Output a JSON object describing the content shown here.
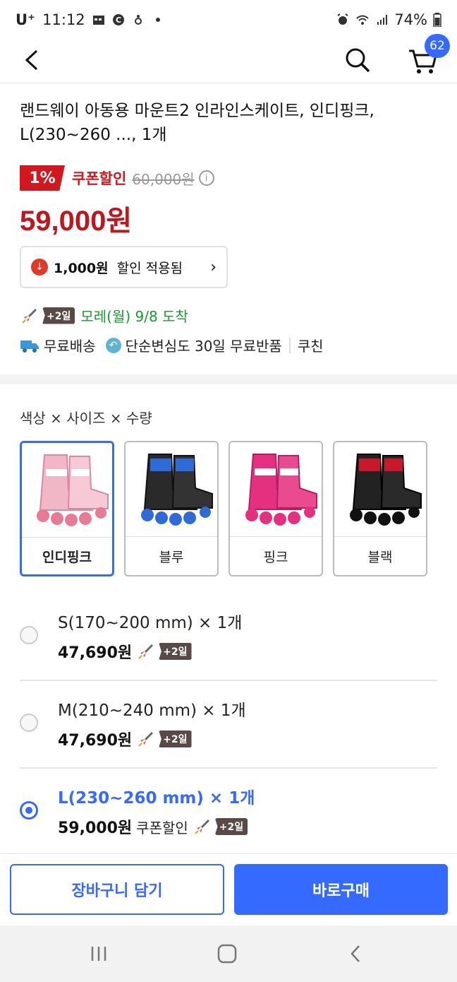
{
  "status": {
    "carrier": "U⁺",
    "time": "11:12",
    "battery": "74%"
  },
  "header": {
    "cart_count": "62"
  },
  "product": {
    "title": "랜드웨이 아동용 마운트2 인라인스케이트, 인디핑크, L(230~260 ..., 1개",
    "discount_pct": "1%",
    "coupon_label": "쿠폰할인",
    "original_price": "60,000원",
    "sale_price": "59,000원",
    "discount_amount": "1,000원",
    "discount_applied": "할인 적용됨",
    "arrival_badge": "+2일",
    "arrival_text": "모레(월) 9/8 도착",
    "free_shipping": "무료배송",
    "free_return": "단순변심도 30일 무료반품",
    "seller": "쿠친"
  },
  "options": {
    "heading": "색상 × 사이즈 × 수량",
    "colors": [
      {
        "label": "인디핑크",
        "selected": true
      },
      {
        "label": "블루",
        "selected": false
      },
      {
        "label": "핑크",
        "selected": false
      },
      {
        "label": "블랙",
        "selected": false
      }
    ],
    "sizes": [
      {
        "name": "S(170~200 mm) × 1개",
        "price": "47,690원",
        "coupon": "",
        "badge": "+2일",
        "selected": false
      },
      {
        "name": "M(210~240 mm) × 1개",
        "price": "47,690원",
        "coupon": "",
        "badge": "+2일",
        "selected": false
      },
      {
        "name": "L(230~260 mm) × 1개",
        "price": "59,000원",
        "coupon": "쿠폰할인",
        "badge": "+2일",
        "selected": true
      }
    ]
  },
  "actions": {
    "add_to_cart": "장바구니 담기",
    "buy_now": "바로구매"
  },
  "colors": {
    "accent": "#346aff",
    "sale_red": "#c0171e",
    "arrival_green": "#139d2b"
  }
}
